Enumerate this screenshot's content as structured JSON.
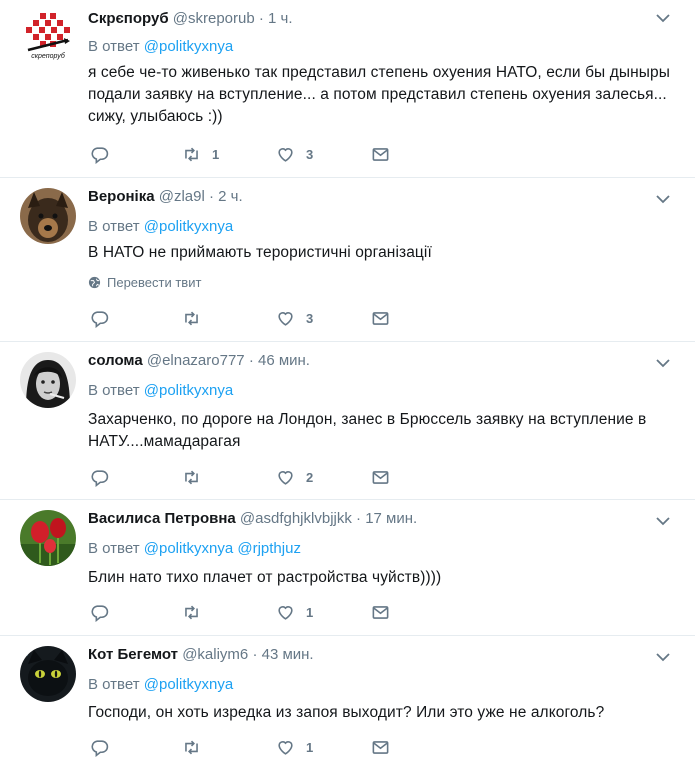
{
  "reply_prefix": "В ответ",
  "translate_label": "Перевести твит",
  "tweets": [
    {
      "name": "Скрєпоруб",
      "handle": "@skreporub",
      "time": "1 ч.",
      "reply_to": [
        "@politkyxnya"
      ],
      "text": "я себе че-то живенько так представил степень охуения НАТО, если бы дыныры подали заявку на вступление... а потом представил степень охуения залесья... сижу, улыбаюсь :))",
      "avatar_caption": "скрепоруб",
      "replies": "",
      "retweets": "1",
      "likes": "3"
    },
    {
      "name": "Вероніка",
      "handle": "@zla9l",
      "time": "2 ч.",
      "reply_to": [
        "@politkyxnya"
      ],
      "text": "В НАТО не приймають терористичні організації",
      "replies": "",
      "retweets": "",
      "likes": "3"
    },
    {
      "name": "солома",
      "handle": "@elnazaro777",
      "time": "46 мин.",
      "reply_to": [
        "@politkyxnya"
      ],
      "text": "Захарченко, по дороге на Лондон, занес в Брюссель заявку на вступление в НАТУ....мамадарагая",
      "replies": "",
      "retweets": "",
      "likes": "2"
    },
    {
      "name": "Василиса Петровна",
      "handle": "@asdfghjklvbjjkk",
      "time": "17 мин.",
      "reply_to": [
        "@politkyxnya",
        "@rjpthjuz"
      ],
      "text": "Блин нато тихо плачет от растройства чуйств))))",
      "replies": "",
      "retweets": "",
      "likes": "1"
    },
    {
      "name": "Кот Бегемот",
      "handle": "@kaliym6",
      "time": "43 мин.",
      "reply_to": [
        "@politkyxnya"
      ],
      "text": "Господи, он хоть изредка из запоя выходит? Или это уже не алкоголь?",
      "replies": "",
      "retweets": "",
      "likes": "1"
    }
  ],
  "colors": {
    "link": "#1da1f2",
    "muted": "#657786",
    "text": "#14171a",
    "divider": "#e6ecf0"
  }
}
